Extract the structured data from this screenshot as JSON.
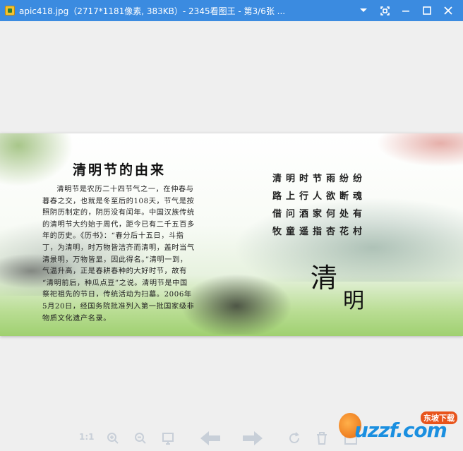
{
  "window": {
    "title": "apic418.jpg（2717*1181像素, 383KB）- 2345看图王 - 第3/6张 ...",
    "controls": [
      "menu-down-icon",
      "fullscreen-icon",
      "minimize-icon",
      "maximize-icon",
      "close-icon"
    ]
  },
  "image": {
    "heading": "清明节的由来",
    "body_lines": [
      "清明节是农历二十四节气之一，在仲春与",
      "暮春之交，也就是冬至后的108天，节气是按",
      "照阴历制定的，阴历没有闰年。中国汉族传统",
      "的清明节大约始于周代，距今已有二千五百多",
      "年的历史。《历书》：“春分后十五日，斗指",
      "丁，为清明，时万物皆洁齐而清明，盖时当气",
      "清景明，万物皆显，因此得名。”清明一到，",
      "气温升高，正是春耕春种的大好时节，故有",
      "“清明前后，种瓜点豆”之说。清明节是中国",
      "祭祀祖先的节日，传统活动为扫墓。2006年",
      "5月20日，经国务院批准列入第一批国家级非",
      "物质文化遗产名录。"
    ],
    "poem_lines": [
      "清明时节雨纷纷",
      "路上行人欲断魂",
      "借问酒家何处有",
      "牧童遥指杏花村"
    ],
    "big_char_1": "清",
    "big_char_2": "明"
  },
  "toolbar": {
    "actual_size_label": "1:1",
    "buttons": [
      "actual-size",
      "zoom-in",
      "zoom-out",
      "fit-window",
      "previous",
      "next",
      "rotate",
      "delete",
      "edit",
      "more"
    ]
  },
  "watermark": {
    "text": "uzzf.com",
    "small": "东坡下载"
  },
  "colors": {
    "titlebar": "#3b8be0",
    "background": "#efefef",
    "toolbar_icon": "#c8cfd8",
    "watermark_blue": "#1a8fe0",
    "watermark_orange": "#e8541c"
  }
}
